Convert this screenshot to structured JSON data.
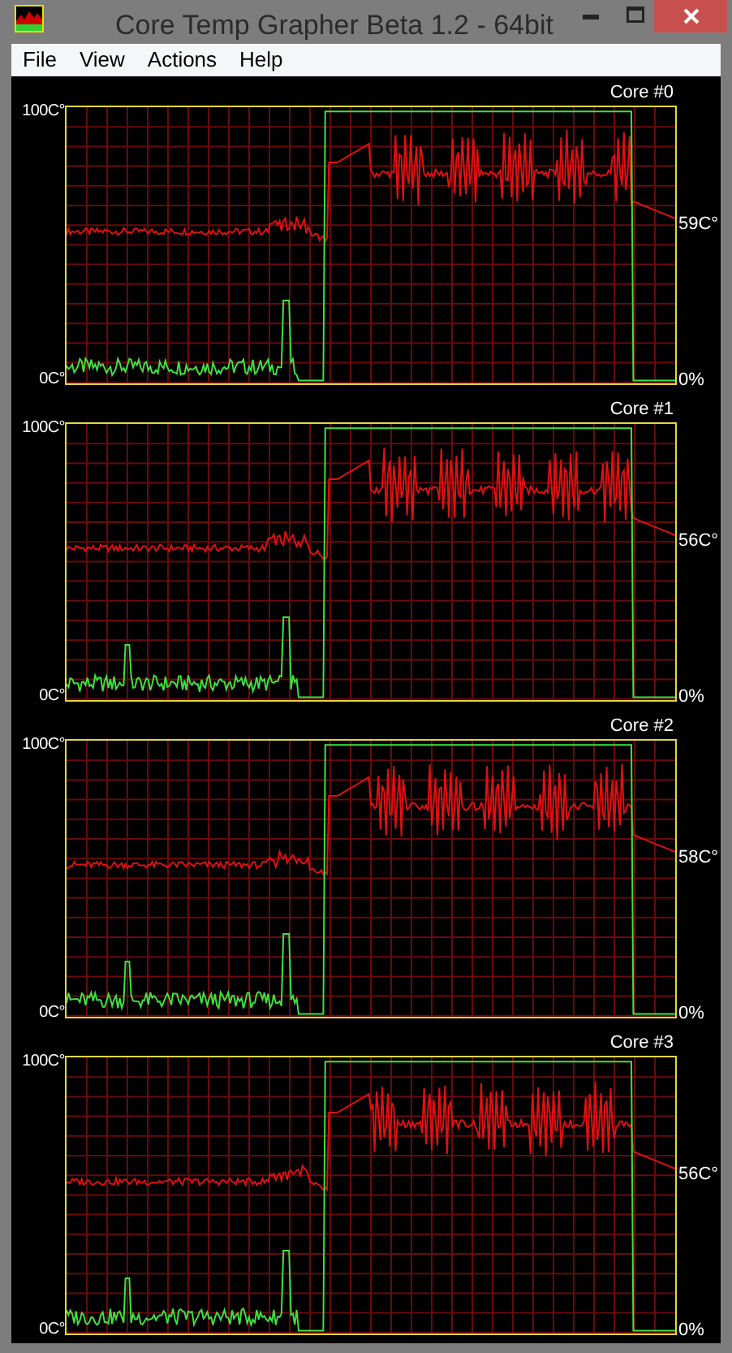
{
  "window": {
    "title": "Core Temp Grapher Beta 1.2 - 64bit"
  },
  "menu": [
    "File",
    "View",
    "Actions",
    "Help"
  ],
  "graphs": [
    {
      "title": "Core #0",
      "y_max_label": "100C°",
      "y_min_label": "0C°",
      "temperature": "59C°",
      "load": "0%"
    },
    {
      "title": "Core #1",
      "y_max_label": "100C°",
      "y_min_label": "0C°",
      "temperature": "56C°",
      "load": "0%"
    },
    {
      "title": "Core #2",
      "y_max_label": "100C°",
      "y_min_label": "0C°",
      "temperature": "58C°",
      "load": "0%"
    },
    {
      "title": "Core #3",
      "y_max_label": "100C°",
      "y_min_label": "0C°",
      "temperature": "56C°",
      "load": "0%"
    }
  ]
}
